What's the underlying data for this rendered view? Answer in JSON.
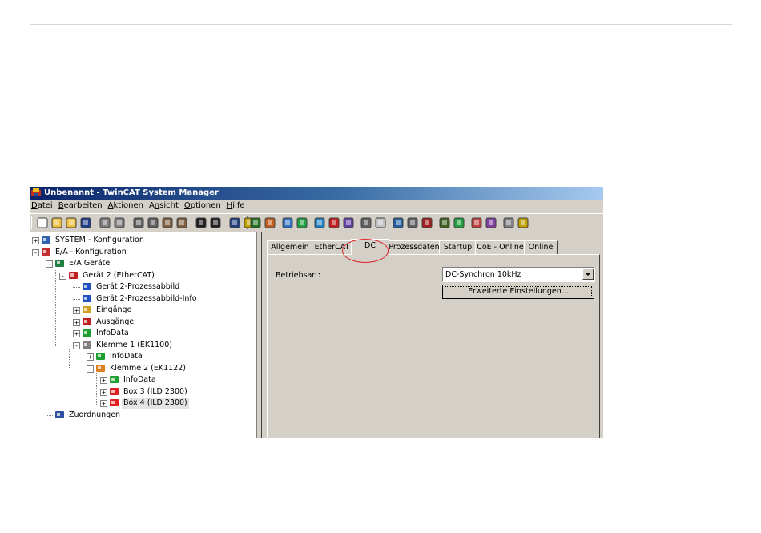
{
  "window": {
    "title": "Unbenannt - TwinCAT System Manager",
    "title_bar_color": "#0a246a"
  },
  "menubar": {
    "items": [
      {
        "mnemonic": "D",
        "rest": "atei"
      },
      {
        "mnemonic": "B",
        "rest": "earbeiten"
      },
      {
        "mnemonic": "A",
        "rest": "ktionen"
      },
      {
        "pre": "A",
        "mnemonic": "n",
        "rest": "sicht"
      },
      {
        "mnemonic": "O",
        "rest": "ptionen"
      },
      {
        "mnemonic": "H",
        "rest": "ilfe"
      }
    ]
  },
  "toolbar": {
    "icons": [
      "new-file-icon",
      "open-folder-icon",
      "open-project-icon",
      "save-icon",
      "print-icon",
      "print-preview-icon",
      "cut-icon",
      "copy-icon",
      "paste-icon",
      "paste-with-links-icon",
      "find-icon",
      "help-pointer-icon",
      "target-system-icon",
      "activate-config-icon",
      "check-config-icon",
      "generate-mappings-icon",
      "scan-devices-icon",
      "set-run-mode-icon",
      "restart-icon",
      "free-run-icon",
      "toggle-mode-icon",
      "show-variables-icon",
      "online-icon",
      "watch-icon",
      "zoom-icon",
      "link-icon",
      "glasses-icon",
      "plc-icon",
      "force-icon",
      "book-icon",
      "info-icon",
      "help-icon"
    ]
  },
  "tree": {
    "nodes": [
      {
        "label": "SYSTEM - Konfiguration",
        "icon": "system-config-icon",
        "expander": "+"
      },
      {
        "label": "E/A - Konfiguration",
        "icon": "io-config-icon",
        "expander": "-"
      },
      {
        "label": "E/A Geräte",
        "icon": "io-devices-icon",
        "expander": "-"
      },
      {
        "label": "Gerät 2 (EtherCAT)",
        "icon": "ethercat-device-icon",
        "expander": "-"
      },
      {
        "label": "Gerät 2-Prozessabbild",
        "icon": "process-image-icon",
        "expander": ""
      },
      {
        "label": "Gerät 2-Prozessabbild-Info",
        "icon": "process-image-icon",
        "expander": ""
      },
      {
        "label": "Eingänge",
        "icon": "inputs-icon",
        "expander": "+"
      },
      {
        "label": "Ausgänge",
        "icon": "outputs-icon",
        "expander": "+"
      },
      {
        "label": "InfoData",
        "icon": "infodata-icon",
        "expander": "+"
      },
      {
        "label": "Klemme 1 (EK1100)",
        "icon": "coupler-terminal-icon",
        "expander": "-"
      },
      {
        "label": "InfoData",
        "icon": "infodata-icon",
        "expander": "+"
      },
      {
        "label": "Klemme 2 (EK1122)",
        "icon": "junction-terminal-icon",
        "expander": "-"
      },
      {
        "label": "InfoData",
        "icon": "infodata-icon",
        "expander": "+"
      },
      {
        "label": "Box 3 (ILD 2300)",
        "icon": "ild-box-icon",
        "expander": "+"
      },
      {
        "label": "Box 4 (ILD 2300)",
        "icon": "ild-box-icon",
        "expander": "+"
      },
      {
        "label": "Zuordnungen",
        "icon": "mappings-icon",
        "expander": ""
      }
    ]
  },
  "tabs": [
    {
      "label": "Allgemein"
    },
    {
      "label": "EtherCAT"
    },
    {
      "label": "DC"
    },
    {
      "label": "Prozessdaten"
    },
    {
      "label": "Startup"
    },
    {
      "label": "CoE - Online"
    },
    {
      "label": "Online"
    }
  ],
  "dc_tab": {
    "mode_label": "Betriebsart:",
    "mode_value": "DC-Synchron 10kHz",
    "advanced_button": "Erweiterte Einstellungen..."
  },
  "annotation": {
    "highlight_color": "#e0242a"
  }
}
